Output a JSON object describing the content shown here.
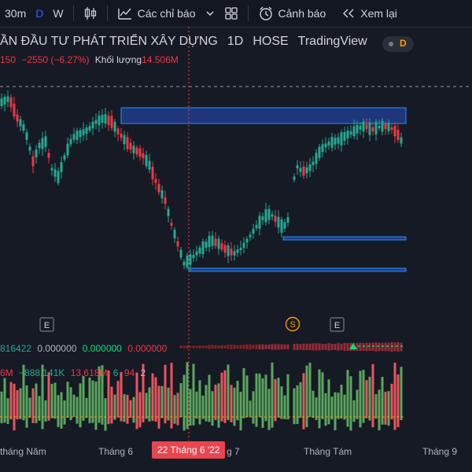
{
  "toolbar": {
    "interval": "30m",
    "interval_d": "D",
    "interval_w": "W",
    "indicators_label": "Các chỉ báo",
    "alerts_label": "Cảnh báo",
    "replay_label": "Xem lại",
    "icons": [
      "candles-icon",
      "indicators-icon",
      "chevron-down-icon",
      "templates-icon",
      "alert-clock-icon",
      "replay-icon"
    ]
  },
  "header": {
    "title": "ẦN ĐẦU TƯ PHÁT TRIỂN XÂY DỰNG",
    "timeframe": "1D",
    "exchange": "HOSE",
    "source": "TradingView",
    "badge": "D"
  },
  "quote": {
    "price_fragment": "150",
    "change": "−2550 (−6.27%)",
    "volume_label": "Khối lượng",
    "volume_value": "14.506M"
  },
  "indicator1": {
    "v1": "816422",
    "v2": "0.000000",
    "v3": "0.000000",
    "v4": "0.000000"
  },
  "indicator2": {
    "v1": "6M",
    "v2": "−888.141K",
    "v3": "13.618M",
    "v4": "6",
    "v5": "94",
    "v6": "2"
  },
  "event_markers": [
    "E",
    "S",
    "E"
  ],
  "xaxis": {
    "labels": [
      "tháng Năm",
      "Tháng 6",
      "g 7",
      "Tháng Tám",
      "Tháng 9"
    ],
    "cursor": "22 Tháng 6 '22"
  },
  "colors": {
    "up": "#22ab94",
    "down": "#f23645",
    "accent": "#2962ff",
    "cursor": "#e9454f",
    "zone_fill": "#1e3c8c",
    "zone_border": "#2196f3"
  }
}
